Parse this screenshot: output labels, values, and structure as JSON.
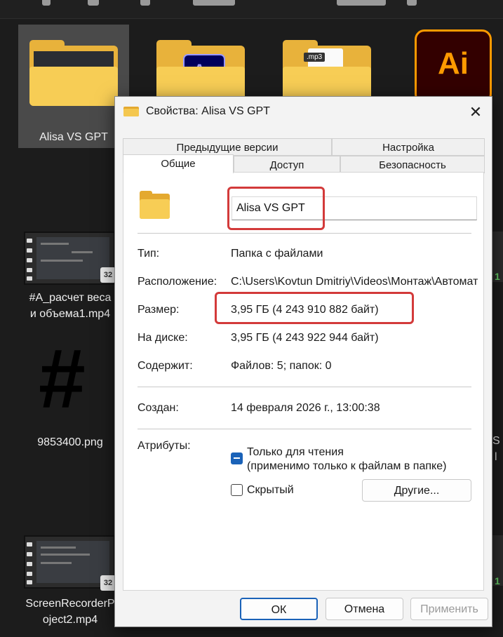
{
  "explorer": {
    "items": [
      {
        "label": "Alisa VS GPT"
      },
      {
        "label": "#A_расчет веса"
      },
      {
        "label": "и объема1.mp4"
      },
      {
        "label": "9853400.png"
      },
      {
        "label": "ScreenRecorderP"
      },
      {
        "label": "oject2.mp4"
      }
    ],
    "ae_text": "Ae",
    "mp3_text": ".mp3",
    "ai_text": "Ai",
    "badge_text": "32",
    "hash_text": "#",
    "right_fragments": [
      "1",
      "1",
      "S",
      "l",
      "1",
      "1"
    ]
  },
  "dialog": {
    "title": "Свойства: Alisa VS GPT",
    "close_glyph": "✕",
    "tabs_back": [
      "Предыдущие версии",
      "Настройка"
    ],
    "tabs_front": [
      "Общие",
      "Доступ",
      "Безопасность"
    ],
    "name_value": "Alisa VS GPT",
    "rows": [
      {
        "label": "Тип:",
        "value": "Папка с файлами"
      },
      {
        "label": "Расположение:",
        "value": "C:\\Users\\Kovtun Dmitriy\\Videos\\Монтаж\\Автомат"
      },
      {
        "label": "Размер:",
        "value": "3,95 ГБ (4 243 910 882 байт)"
      },
      {
        "label": "На диске:",
        "value": "3,95 ГБ (4 243 922 944 байт)"
      },
      {
        "label": "Содержит:",
        "value": "Файлов: 5; папок: 0"
      }
    ],
    "created_label": "Создан:",
    "created_value": "14 февраля 2026 г., 13:00:38",
    "attributes_label": "Атрибуты:",
    "readonly_line1": "Только для чтения",
    "readonly_line2": "(применимо только к файлам в папке)",
    "hidden_label": "Скрытый",
    "other_button": "Другие...",
    "ok_button": "ОК",
    "cancel_button": "Отмена",
    "apply_button": "Применить"
  },
  "colors": {
    "accent": "#1a62b8",
    "highlight": "#d33a3a",
    "folder": "#f7cd55"
  }
}
